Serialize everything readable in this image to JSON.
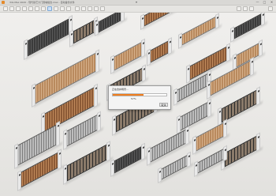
{
  "window": {
    "title": "3ds Max 2020 - 现代铁艺大门围墙组合.max - 自动备份文件",
    "controls": {
      "minimize": "—",
      "maximize": "□",
      "close": "✕"
    }
  },
  "toolbar": {
    "icons": [
      "new-file-icon",
      "open-icon",
      "save-icon",
      "undo-icon",
      "redo-icon",
      "link-icon",
      "unlink-icon",
      "select-icon",
      "move-icon",
      "rotate-icon",
      "scale-icon",
      "snap-icon",
      "mirror-icon",
      "align-icon",
      "layer-icon",
      "render-icon",
      "material-icon",
      "render-frame-icon",
      "view-icon",
      "help-icon"
    ]
  },
  "dialog": {
    "message": "正在合并场景...",
    "progress": 0.57,
    "percent_text": "57%",
    "cancel_label": "取消"
  },
  "colors": {
    "accent": "#ef7d1e",
    "viewport_bg": "#ecebe8"
  },
  "fences": [
    {
      "style": "dark-slat"
    },
    {
      "style": "light-wood"
    },
    {
      "style": "steel-gray"
    },
    {
      "style": "wood-vertical"
    },
    {
      "style": "dark-frame"
    }
  ]
}
